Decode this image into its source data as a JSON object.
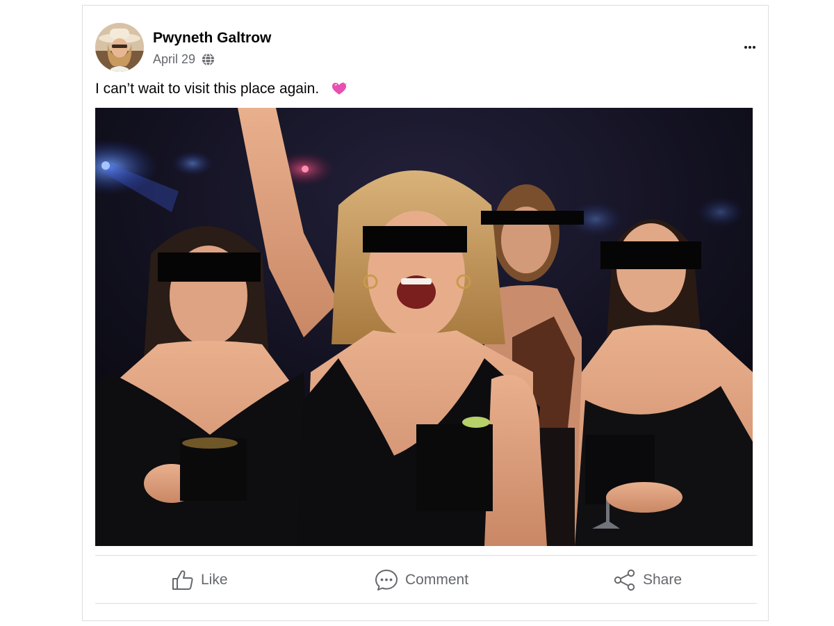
{
  "post": {
    "author": "Pwyneth Galtrow",
    "date": "April 29",
    "audience_icon": "globe-icon",
    "more_icon": "more-horizontal-icon",
    "text": "I can’t wait to visit this place again.",
    "emoji_icon": "sparkling-heart-icon",
    "photo_description_icons": [
      "group-photo-nightclub"
    ]
  },
  "actions": {
    "like": {
      "label": "Like",
      "icon": "thumbs-up-icon"
    },
    "comment": {
      "label": "Comment",
      "icon": "comment-bubble-icon"
    },
    "share": {
      "label": "Share",
      "icon": "share-nodes-icon"
    }
  },
  "colors": {
    "text_primary": "#050505",
    "text_secondary": "#65676b",
    "divider": "#dadde1",
    "emoji_pink": "#e84fb0"
  }
}
